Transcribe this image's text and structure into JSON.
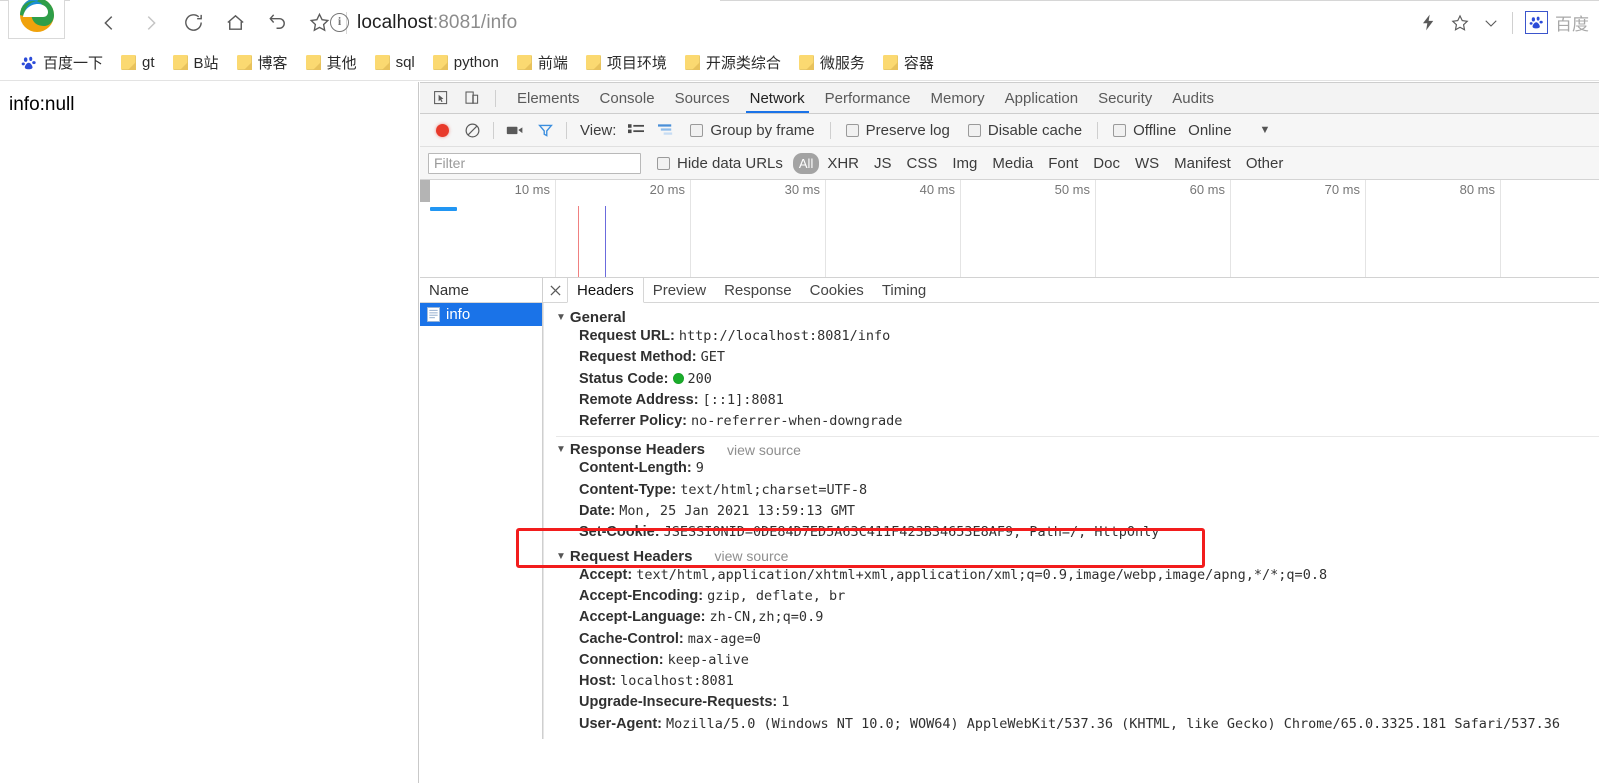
{
  "browser": {
    "url_scheme_hidden": "",
    "url_host": "localhost",
    "url_rest": ":8081/info",
    "nav": {
      "back": "back-arrow",
      "forward": "forward-arrow",
      "reload": "reload",
      "home": "home",
      "undo": "undo",
      "favorite": "star"
    },
    "topright": {
      "lightning": "lightning-bolt",
      "star": "star-outline",
      "chevron": "chevron-down",
      "baidu_label": "百度"
    },
    "bookmarks": [
      {
        "label": "百度一下",
        "icon": "baidu-paw-icon"
      },
      {
        "label": "gt",
        "icon": "folder-icon"
      },
      {
        "label": "B站",
        "icon": "folder-icon"
      },
      {
        "label": "博客",
        "icon": "folder-icon"
      },
      {
        "label": "其他",
        "icon": "folder-icon"
      },
      {
        "label": "sql",
        "icon": "folder-icon"
      },
      {
        "label": "python",
        "icon": "folder-icon"
      },
      {
        "label": "前端",
        "icon": "folder-icon"
      },
      {
        "label": "项目环境",
        "icon": "folder-icon"
      },
      {
        "label": "开源类综合",
        "icon": "folder-icon"
      },
      {
        "label": "微服务",
        "icon": "folder-icon"
      },
      {
        "label": "容器",
        "icon": "folder-icon"
      }
    ]
  },
  "page": {
    "body_text": "info:null"
  },
  "devtools": {
    "tabs": [
      {
        "label": "Elements",
        "active": false
      },
      {
        "label": "Console",
        "active": false
      },
      {
        "label": "Sources",
        "active": false
      },
      {
        "label": "Network",
        "active": true
      },
      {
        "label": "Performance",
        "active": false
      },
      {
        "label": "Memory",
        "active": false
      },
      {
        "label": "Application",
        "active": false
      },
      {
        "label": "Security",
        "active": false
      },
      {
        "label": "Audits",
        "active": false
      }
    ],
    "network_toolbar": {
      "record_title": "record-button",
      "clear_title": "clear-button",
      "camera_title": "screenshot-camera",
      "filter_title": "filter-funnel",
      "view_label": "View:",
      "group_by_frame": "Group by frame",
      "preserve_log": "Preserve log",
      "disable_cache": "Disable cache",
      "offline": "Offline",
      "throttle_value": "Online"
    },
    "filter_bar": {
      "filter_placeholder": "Filter",
      "filter_value": "",
      "hide_data_urls": "Hide data URLs",
      "types": [
        "All",
        "XHR",
        "JS",
        "CSS",
        "Img",
        "Media",
        "Font",
        "Doc",
        "WS",
        "Manifest",
        "Other"
      ],
      "selected_type": "All"
    },
    "timeline": {
      "ticks": [
        "10 ms",
        "20 ms",
        "30 ms",
        "40 ms",
        "50 ms",
        "60 ms",
        "70 ms",
        "80 ms"
      ],
      "request_bar_color": "#2196f3",
      "dom_content_loaded_color": "#f08080",
      "load_event_color": "#6b6bdd"
    },
    "request_list": {
      "column_header": "Name",
      "rows": [
        {
          "name": "info",
          "icon": "document-icon",
          "selected": true
        }
      ]
    },
    "detail_tabs": [
      {
        "label": "Headers",
        "active": true
      },
      {
        "label": "Preview",
        "active": false
      },
      {
        "label": "Response",
        "active": false
      },
      {
        "label": "Cookies",
        "active": false
      },
      {
        "label": "Timing",
        "active": false
      }
    ],
    "headers": {
      "general": {
        "title": "General",
        "rows": [
          {
            "key": "Request URL:",
            "value": "http://localhost:8081/info"
          },
          {
            "key": "Request Method:",
            "value": "GET"
          },
          {
            "key": "Status Code:",
            "value": "200",
            "has_status_dot": true
          },
          {
            "key": "Remote Address:",
            "value": "[::1]:8081"
          },
          {
            "key": "Referrer Policy:",
            "value": "no-referrer-when-downgrade"
          }
        ]
      },
      "response_headers": {
        "title": "Response Headers",
        "view_source": "view source",
        "rows": [
          {
            "key": "Content-Length:",
            "value": "9"
          },
          {
            "key": "Content-Type:",
            "value": "text/html;charset=UTF-8"
          },
          {
            "key": "Date:",
            "value": "Mon, 25 Jan 2021 13:59:13 GMT"
          },
          {
            "key": "Set-Cookie:",
            "value": "JSESSIONID=0DE84D7ED5A63C411F423B34653E8AF9; Path=/; HttpOnly",
            "highlighted": true
          }
        ]
      },
      "request_headers": {
        "title": "Request Headers",
        "view_source": "view source",
        "rows": [
          {
            "key": "Accept:",
            "value": "text/html,application/xhtml+xml,application/xml;q=0.9,image/webp,image/apng,*/*;q=0.8"
          },
          {
            "key": "Accept-Encoding:",
            "value": "gzip, deflate, br"
          },
          {
            "key": "Accept-Language:",
            "value": "zh-CN,zh;q=0.9"
          },
          {
            "key": "Cache-Control:",
            "value": "max-age=0"
          },
          {
            "key": "Connection:",
            "value": "keep-alive"
          },
          {
            "key": "Host:",
            "value": "localhost:8081"
          },
          {
            "key": "Upgrade-Insecure-Requests:",
            "value": "1"
          },
          {
            "key": "User-Agent:",
            "value": "Mozilla/5.0 (Windows NT 10.0; WOW64) AppleWebKit/537.36 (KHTML, like Gecko) Chrome/65.0.3325.181 Safari/537.36"
          }
        ]
      }
    },
    "annotation": {
      "highlight_color": "#f21d1d"
    }
  }
}
